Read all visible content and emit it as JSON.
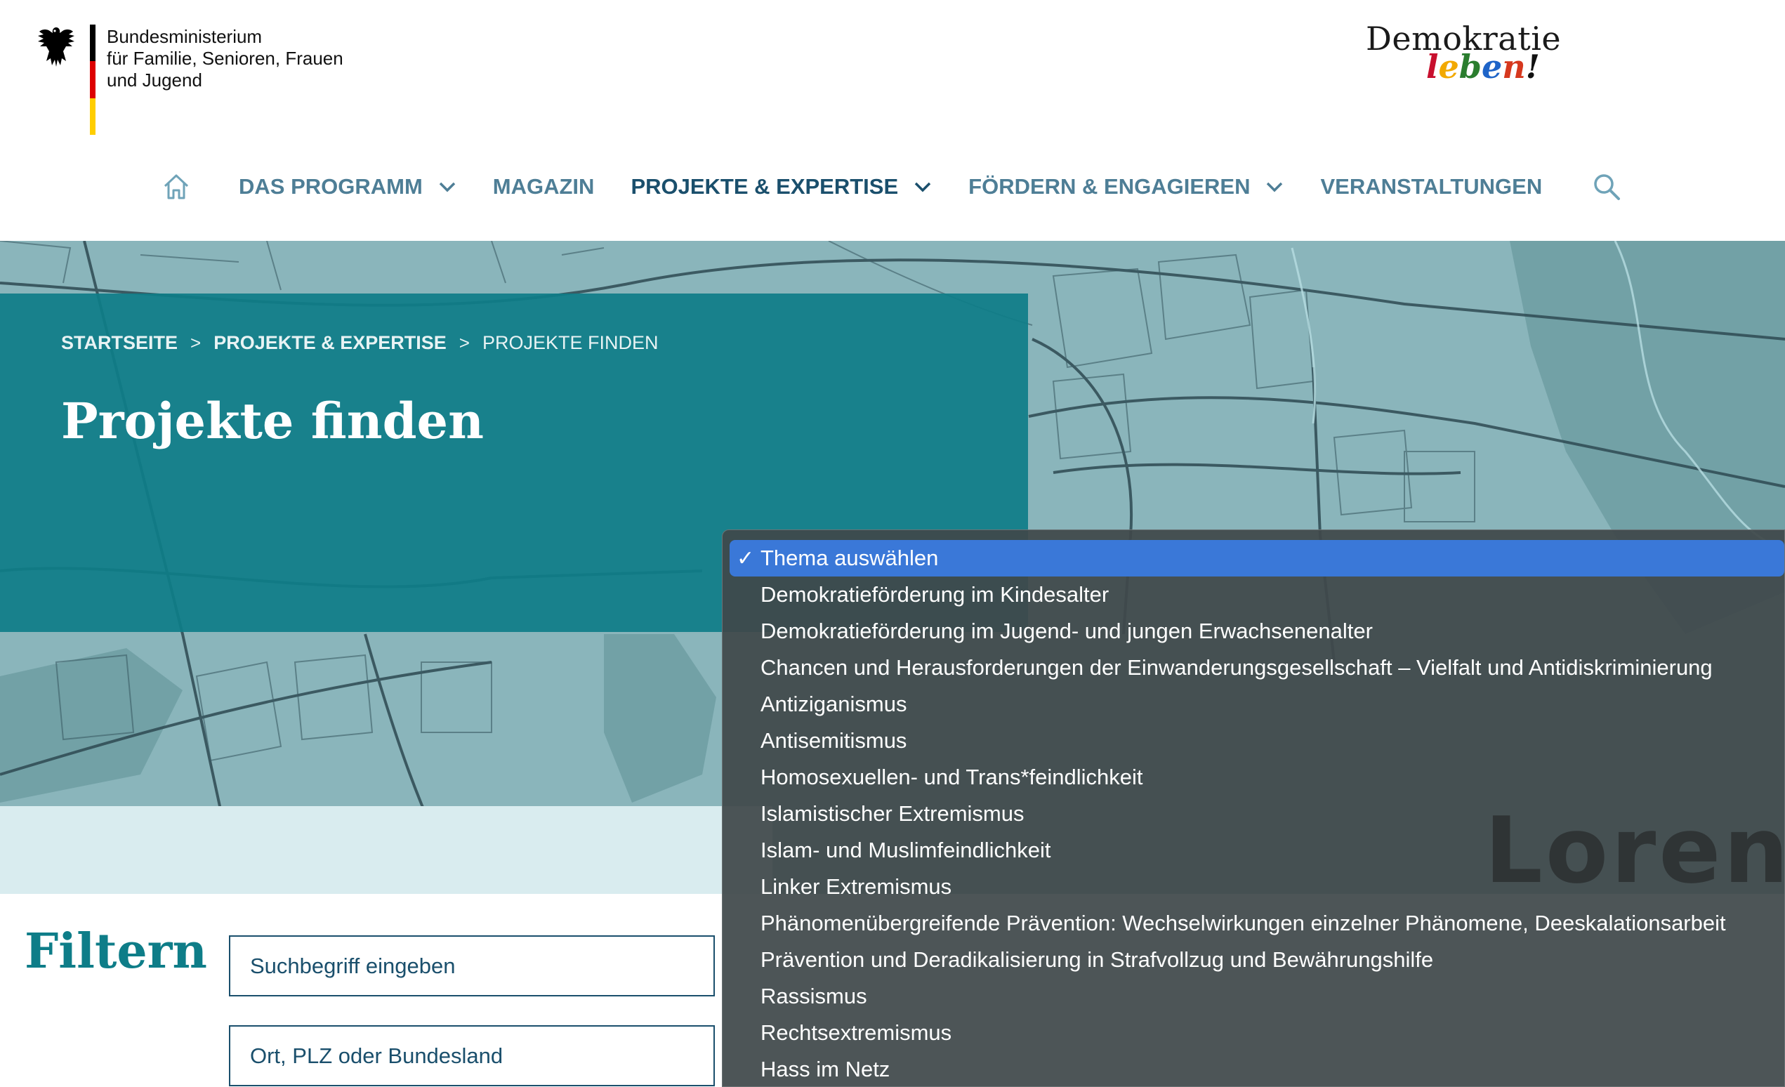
{
  "header": {
    "ministry_lines": [
      "Bundesministerium",
      "für Familie, Senioren, Frauen",
      "und Jugend"
    ],
    "logo_line1": "Demokratie",
    "logo_line2_letters": [
      "l",
      "e",
      "b",
      "e",
      "n",
      "!"
    ],
    "logo_colors": [
      "#c8102e",
      "#f2a900",
      "#2a7d2e",
      "#1e64c8",
      "#d6381e",
      "#111111"
    ],
    "flag_colors": [
      "#000000",
      "#dd0000",
      "#ffce00"
    ]
  },
  "nav": {
    "items": [
      {
        "label": "DAS PROGRAMM",
        "dropdown": true
      },
      {
        "label": "MAGAZIN",
        "dropdown": false
      },
      {
        "label": "PROJEKTE & EXPERTISE",
        "dropdown": true,
        "active": true
      },
      {
        "label": "FÖRDERN & ENGAGIEREN",
        "dropdown": true
      },
      {
        "label": "VERANSTALTUNGEN",
        "dropdown": false
      }
    ],
    "home_icon": "home-icon",
    "search_icon": "search-icon"
  },
  "breadcrumb": {
    "items": [
      "STARTSEITE",
      "PROJEKTE & EXPERTISE",
      "PROJEKTE FINDEN"
    ],
    "separator": ">"
  },
  "page": {
    "title": "Projekte finden"
  },
  "filter": {
    "title": "Filtern",
    "search_placeholder": "Suchbegriff eingeben",
    "location_placeholder": "Ort, PLZ oder Bundesland"
  },
  "dropdown": {
    "background_text": "Loren",
    "check": "✓",
    "options": [
      {
        "label": "Thema auswählen",
        "selected": true
      },
      {
        "label": "Demokratieförderung im Kindesalter"
      },
      {
        "label": "Demokratieförderung im Jugend- und jungen Erwachsenenalter"
      },
      {
        "label": "Chancen und Herausforderungen der Einwanderungsgesellschaft – Vielfalt und Antidiskriminierung"
      },
      {
        "label": "Antiziganismus"
      },
      {
        "label": "Antisemitismus"
      },
      {
        "label": "Homosexuellen- und Trans*feindlichkeit"
      },
      {
        "label": "Islamistischer Extremismus"
      },
      {
        "label": "Islam- und Muslimfeindlichkeit"
      },
      {
        "label": "Linker Extremismus"
      },
      {
        "label": "Phänomenübergreifende Prävention: Wechselwirkungen einzelner Phänomene, Deeskalationsarbeit"
      },
      {
        "label": "Prävention und Deradikalisierung in Strafvollzug und Bewährungshilfe"
      },
      {
        "label": "Rassismus"
      },
      {
        "label": "Rechtsextremismus"
      },
      {
        "label": "Hass im Netz"
      }
    ]
  },
  "colors": {
    "teal": "#0e7d88",
    "navy": "#1a4f6c",
    "nav_text": "#4e7e96",
    "dropdown_selected": "#3a78d8"
  }
}
